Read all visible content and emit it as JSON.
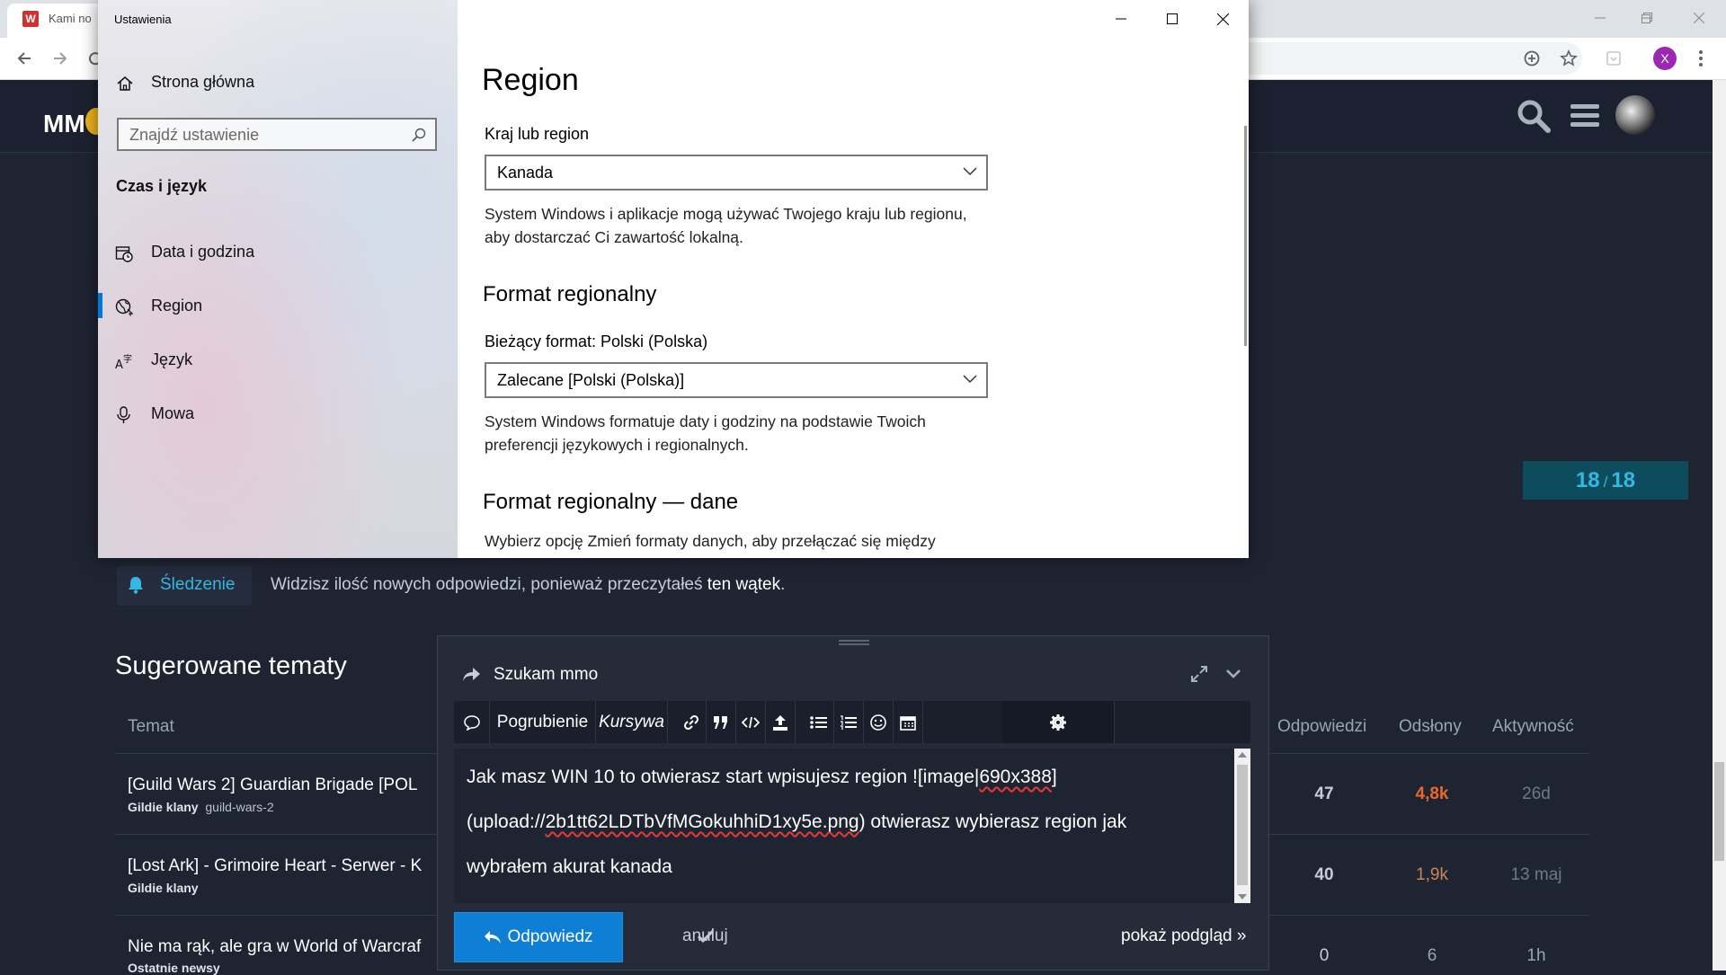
{
  "browser": {
    "tab_title": "Kami no",
    "tab_favicon_letter": "W",
    "profile_letter": "X"
  },
  "forum": {
    "logo_text": "MM",
    "progress": {
      "current": "18",
      "separator": "/",
      "total": "18"
    },
    "tracking": {
      "label": "Śledzenie",
      "text_before": "Widzisz ilość nowych odpowiedzi, ponieważ przeczytałeś ",
      "text_link": "ten wątek",
      "text_after": "."
    },
    "suggested": {
      "title": "Sugerowane tematy",
      "columns": {
        "topic": "Temat",
        "replies": "Odpowiedzi",
        "views": "Odsłony",
        "activity": "Aktywność"
      },
      "rows": [
        {
          "title": "[Guild Wars 2] Guardian Brigade [POL",
          "category": "Gildie klany",
          "tag": "guild-wars-2",
          "replies": "47",
          "views": "4,8k",
          "activity": "26d",
          "views_color": "#e8682a"
        },
        {
          "title": "[Lost Ark] - Grimoire Heart - Serwer - K",
          "category": "Gildie klany",
          "tag": "",
          "replies": "40",
          "views": "1,9k",
          "activity": "13 maj",
          "views_color": "#c98553"
        },
        {
          "title": "Nie ma rąk, ale gra w World of Warcraf",
          "category": "Ostatnie newsy",
          "tag": "",
          "replies": "0",
          "views": "6",
          "activity": "1h",
          "views_color": "#9aa3b2"
        }
      ]
    }
  },
  "settings": {
    "window_title": "Ustawienia",
    "home_label": "Strona główna",
    "search_placeholder": "Znajdź ustawienie",
    "section": "Czas i język",
    "nav": [
      {
        "label": "Data i godzina",
        "icon": "calendar-clock-icon"
      },
      {
        "label": "Region",
        "icon": "globe-icon",
        "selected": true
      },
      {
        "label": "Język",
        "icon": "language-icon"
      },
      {
        "label": "Mowa",
        "icon": "microphone-icon"
      }
    ],
    "page_title": "Region",
    "country_label": "Kraj lub region",
    "country_value": "Kanada",
    "country_desc": "System Windows i aplikacje mogą używać Twojego kraju lub regionu, aby dostarczać Ci zawartość lokalną.",
    "format_heading": "Format regionalny",
    "current_format": "Bieżący format: Polski (Polska)",
    "format_value": "Zalecane [Polski (Polska)]",
    "format_desc": "System Windows formatuje daty i godziny na podstawie Twoich preferencji językowych i regionalnych.",
    "data_heading": "Format regionalny — dane",
    "data_desc": "Wybierz opcję Zmień formaty danych, aby przełączać się między"
  },
  "composer": {
    "topic": "Szukam mmo",
    "bold_label": "Pogrubienie",
    "italic_label": "Kursywa",
    "text_line1_a": "Jak masz WIN 10 to otwierasz start wpisujesz region ![image|",
    "text_line1_b": "690x388",
    "text_line1_c": "]",
    "text_line2_a": "(upload://",
    "text_line2_b": "2b1tt62LDTbVfMGokuhhiD1xy5e.png",
    "text_line2_c": ") otwierasz wybierasz region jak",
    "text_line3": "wybrałem akurat kanada",
    "reply_label": "Odpowiedz",
    "cancel_label": "anuluj",
    "preview_label": "pokaż podgląd »"
  },
  "colors": {
    "accent": "#0078d7",
    "forum_bg": "#1f2433",
    "link_blue": "#34b7e0",
    "reply_btn": "#0f7fd6"
  }
}
